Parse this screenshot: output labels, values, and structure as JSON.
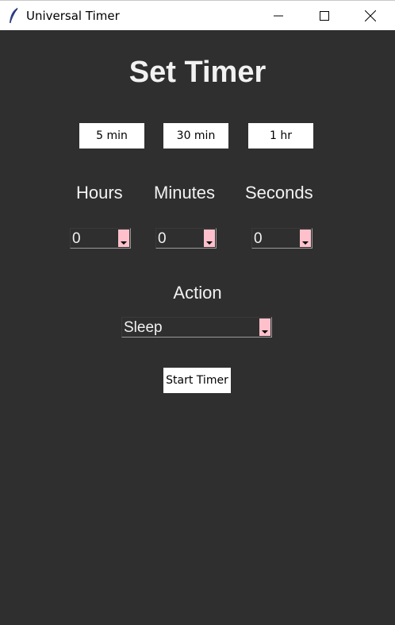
{
  "window": {
    "title": "Universal Timer",
    "icon": "feather-icon",
    "controls": [
      "minimize-icon",
      "maximize-icon",
      "close-icon"
    ]
  },
  "main": {
    "heading": "Set Timer",
    "presets": [
      {
        "label": "5 min"
      },
      {
        "label": "30 min"
      },
      {
        "label": "1 hr"
      }
    ],
    "fields": {
      "hours": {
        "label": "Hours",
        "value": "0"
      },
      "minutes": {
        "label": "Minutes",
        "value": "0"
      },
      "seconds": {
        "label": "Seconds",
        "value": "0"
      }
    },
    "action": {
      "label": "Action",
      "value": "Sleep"
    },
    "start_button": "Start Timer"
  },
  "colors": {
    "background": "#2f2f2f",
    "text": "#f2f2f2",
    "dropdown_arrow": "#ffc0cb",
    "button_bg": "#ffffff"
  }
}
